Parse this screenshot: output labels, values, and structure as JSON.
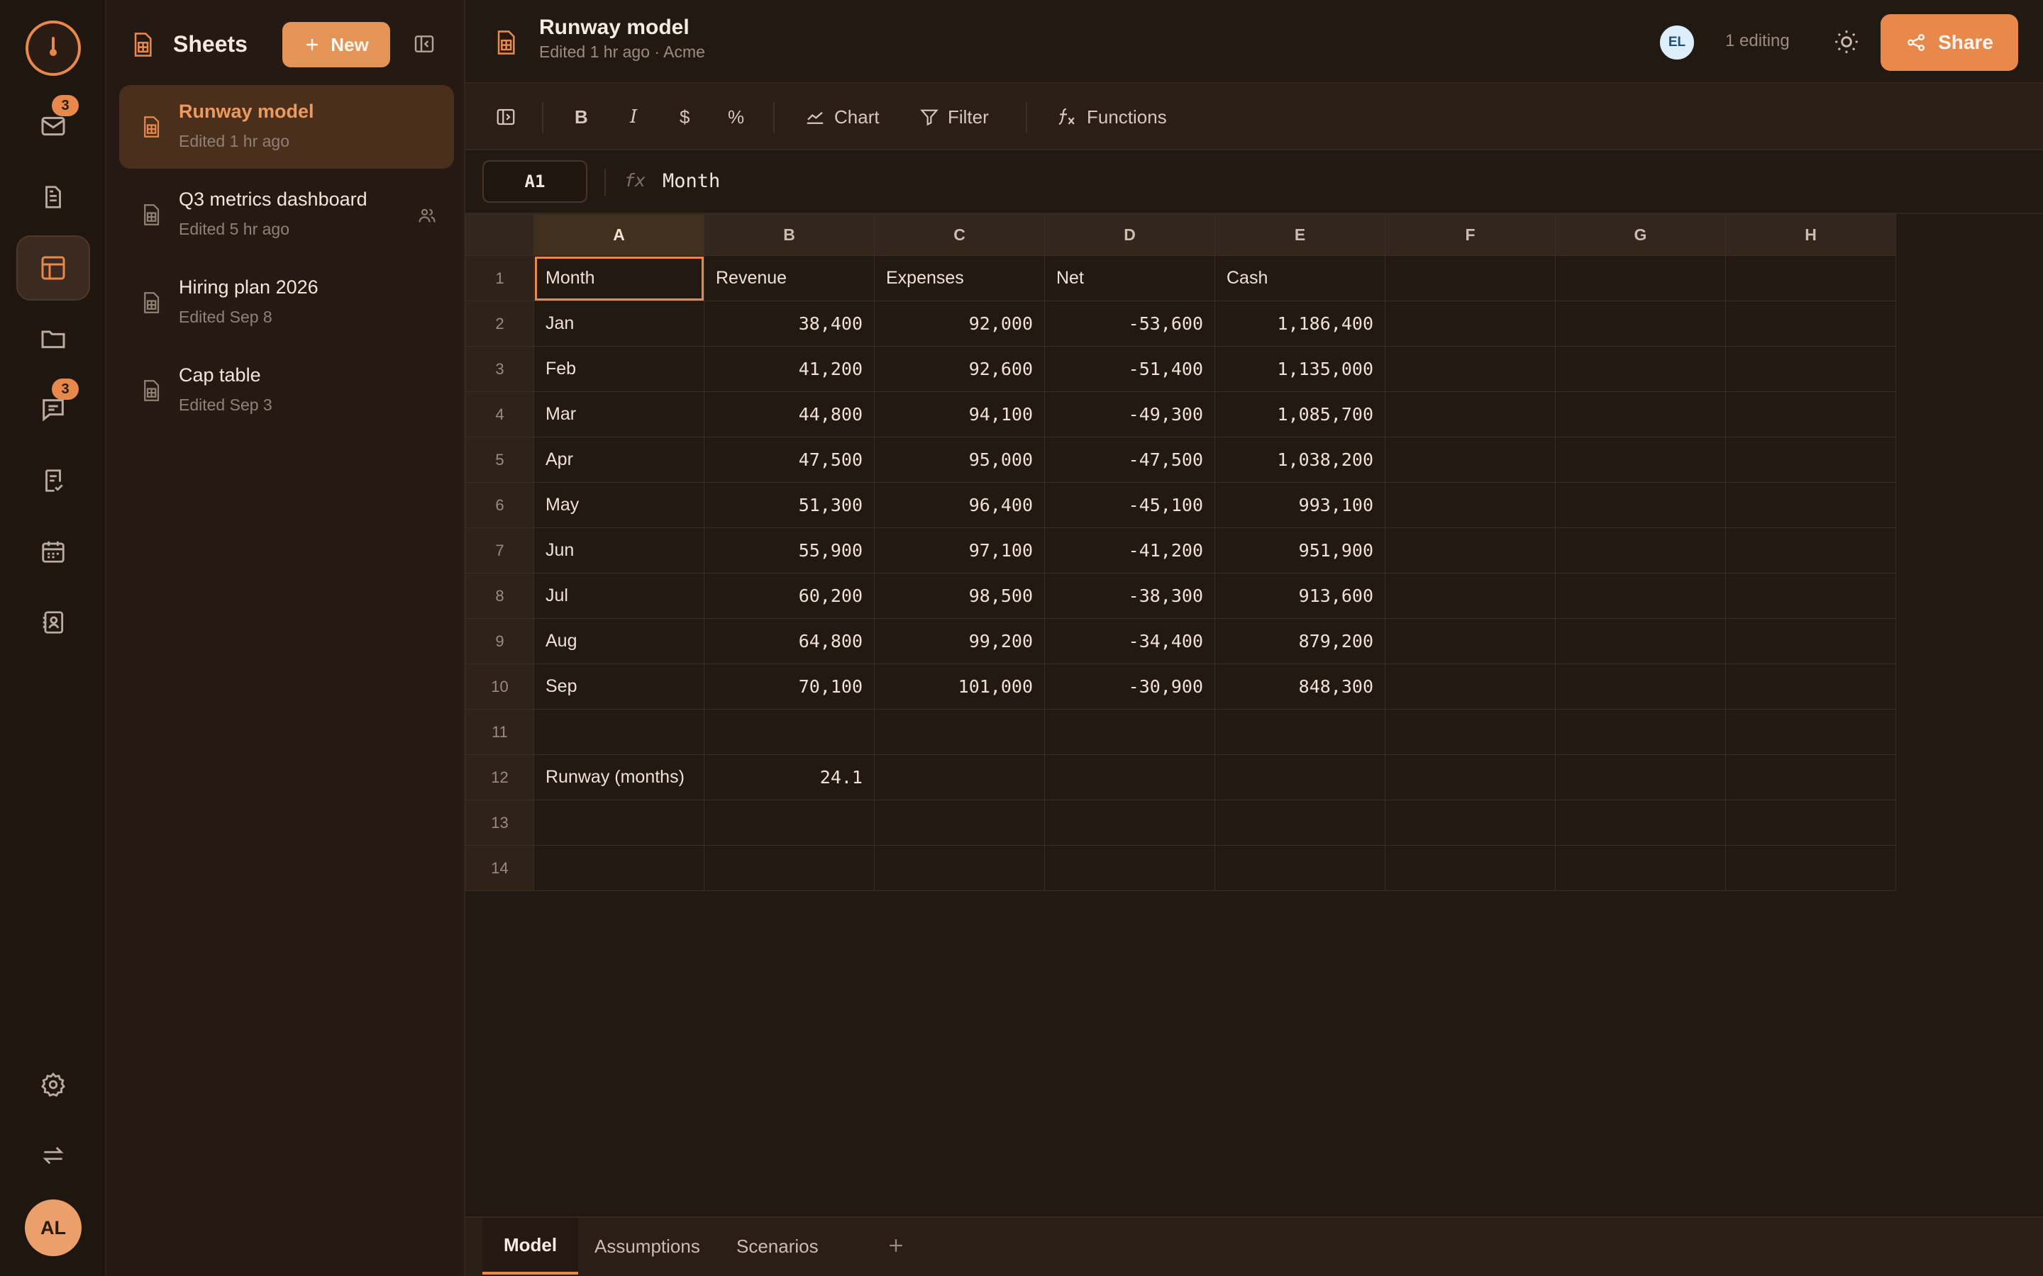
{
  "rail": {
    "items": [
      {
        "icon": "mail-icon",
        "badge": "3"
      },
      {
        "icon": "document-icon",
        "badge": ""
      },
      {
        "icon": "sheets-icon",
        "badge": "",
        "active": true
      },
      {
        "icon": "folder-icon",
        "badge": ""
      },
      {
        "icon": "chat-icon",
        "badge": "3"
      },
      {
        "icon": "checklist-icon",
        "badge": ""
      },
      {
        "icon": "calendar-icon",
        "badge": ""
      },
      {
        "icon": "contacts-icon",
        "badge": ""
      }
    ],
    "avatar": "AL"
  },
  "panel": {
    "title": "Sheets",
    "new_label": "New",
    "files": [
      {
        "name": "Runway model",
        "date": "Edited 1 hr ago",
        "active": true,
        "shared": false
      },
      {
        "name": "Q3 metrics dashboard",
        "date": "Edited 5 hr ago",
        "active": false,
        "shared": true
      },
      {
        "name": "Hiring plan 2026",
        "date": "Edited Sep 8",
        "active": false,
        "shared": false
      },
      {
        "name": "Cap table",
        "date": "Edited Sep 3",
        "active": false,
        "shared": false
      }
    ]
  },
  "header": {
    "title": "Runway model",
    "subtitle": "Edited 1 hr ago · Acme",
    "collaborator": "EL",
    "editing": "1 editing",
    "share_label": "Share"
  },
  "toolbar": {
    "bold": "B",
    "italic": "I",
    "currency": "$",
    "percent": "%",
    "chart": "Chart",
    "filter": "Filter",
    "functions": "Functions"
  },
  "formula": {
    "cell": "A1",
    "fx": "fx",
    "value": "Month"
  },
  "grid": {
    "columns": [
      "A",
      "B",
      "C",
      "D",
      "E",
      "F",
      "G",
      "H"
    ],
    "rows": [
      [
        "Month",
        "Revenue",
        "Expenses",
        "Net",
        "Cash",
        "",
        "",
        ""
      ],
      [
        "Jan",
        "38,400",
        "92,000",
        "-53,600",
        "1,186,400",
        "",
        "",
        ""
      ],
      [
        "Feb",
        "41,200",
        "92,600",
        "-51,400",
        "1,135,000",
        "",
        "",
        ""
      ],
      [
        "Mar",
        "44,800",
        "94,100",
        "-49,300",
        "1,085,700",
        "",
        "",
        ""
      ],
      [
        "Apr",
        "47,500",
        "95,000",
        "-47,500",
        "1,038,200",
        "",
        "",
        ""
      ],
      [
        "May",
        "51,300",
        "96,400",
        "-45,100",
        "993,100",
        "",
        "",
        ""
      ],
      [
        "Jun",
        "55,900",
        "97,100",
        "-41,200",
        "951,900",
        "",
        "",
        ""
      ],
      [
        "Jul",
        "60,200",
        "98,500",
        "-38,300",
        "913,600",
        "",
        "",
        ""
      ],
      [
        "Aug",
        "64,800",
        "99,200",
        "-34,400",
        "879,200",
        "",
        "",
        ""
      ],
      [
        "Sep",
        "70,100",
        "101,000",
        "-30,900",
        "848,300",
        "",
        "",
        ""
      ],
      [
        "",
        "",
        "",
        "",
        "",
        "",
        "",
        ""
      ],
      [
        "Runway (months)",
        "24.1",
        "",
        "",
        "",
        "",
        "",
        ""
      ],
      [
        "",
        "",
        "",
        "",
        "",
        "",
        "",
        ""
      ],
      [
        "",
        "",
        "",
        "",
        "",
        "",
        "",
        ""
      ]
    ]
  },
  "sheet_tabs": [
    {
      "label": "Model",
      "active": true
    },
    {
      "label": "Assumptions",
      "active": false
    },
    {
      "label": "Scenarios",
      "active": false
    }
  ]
}
